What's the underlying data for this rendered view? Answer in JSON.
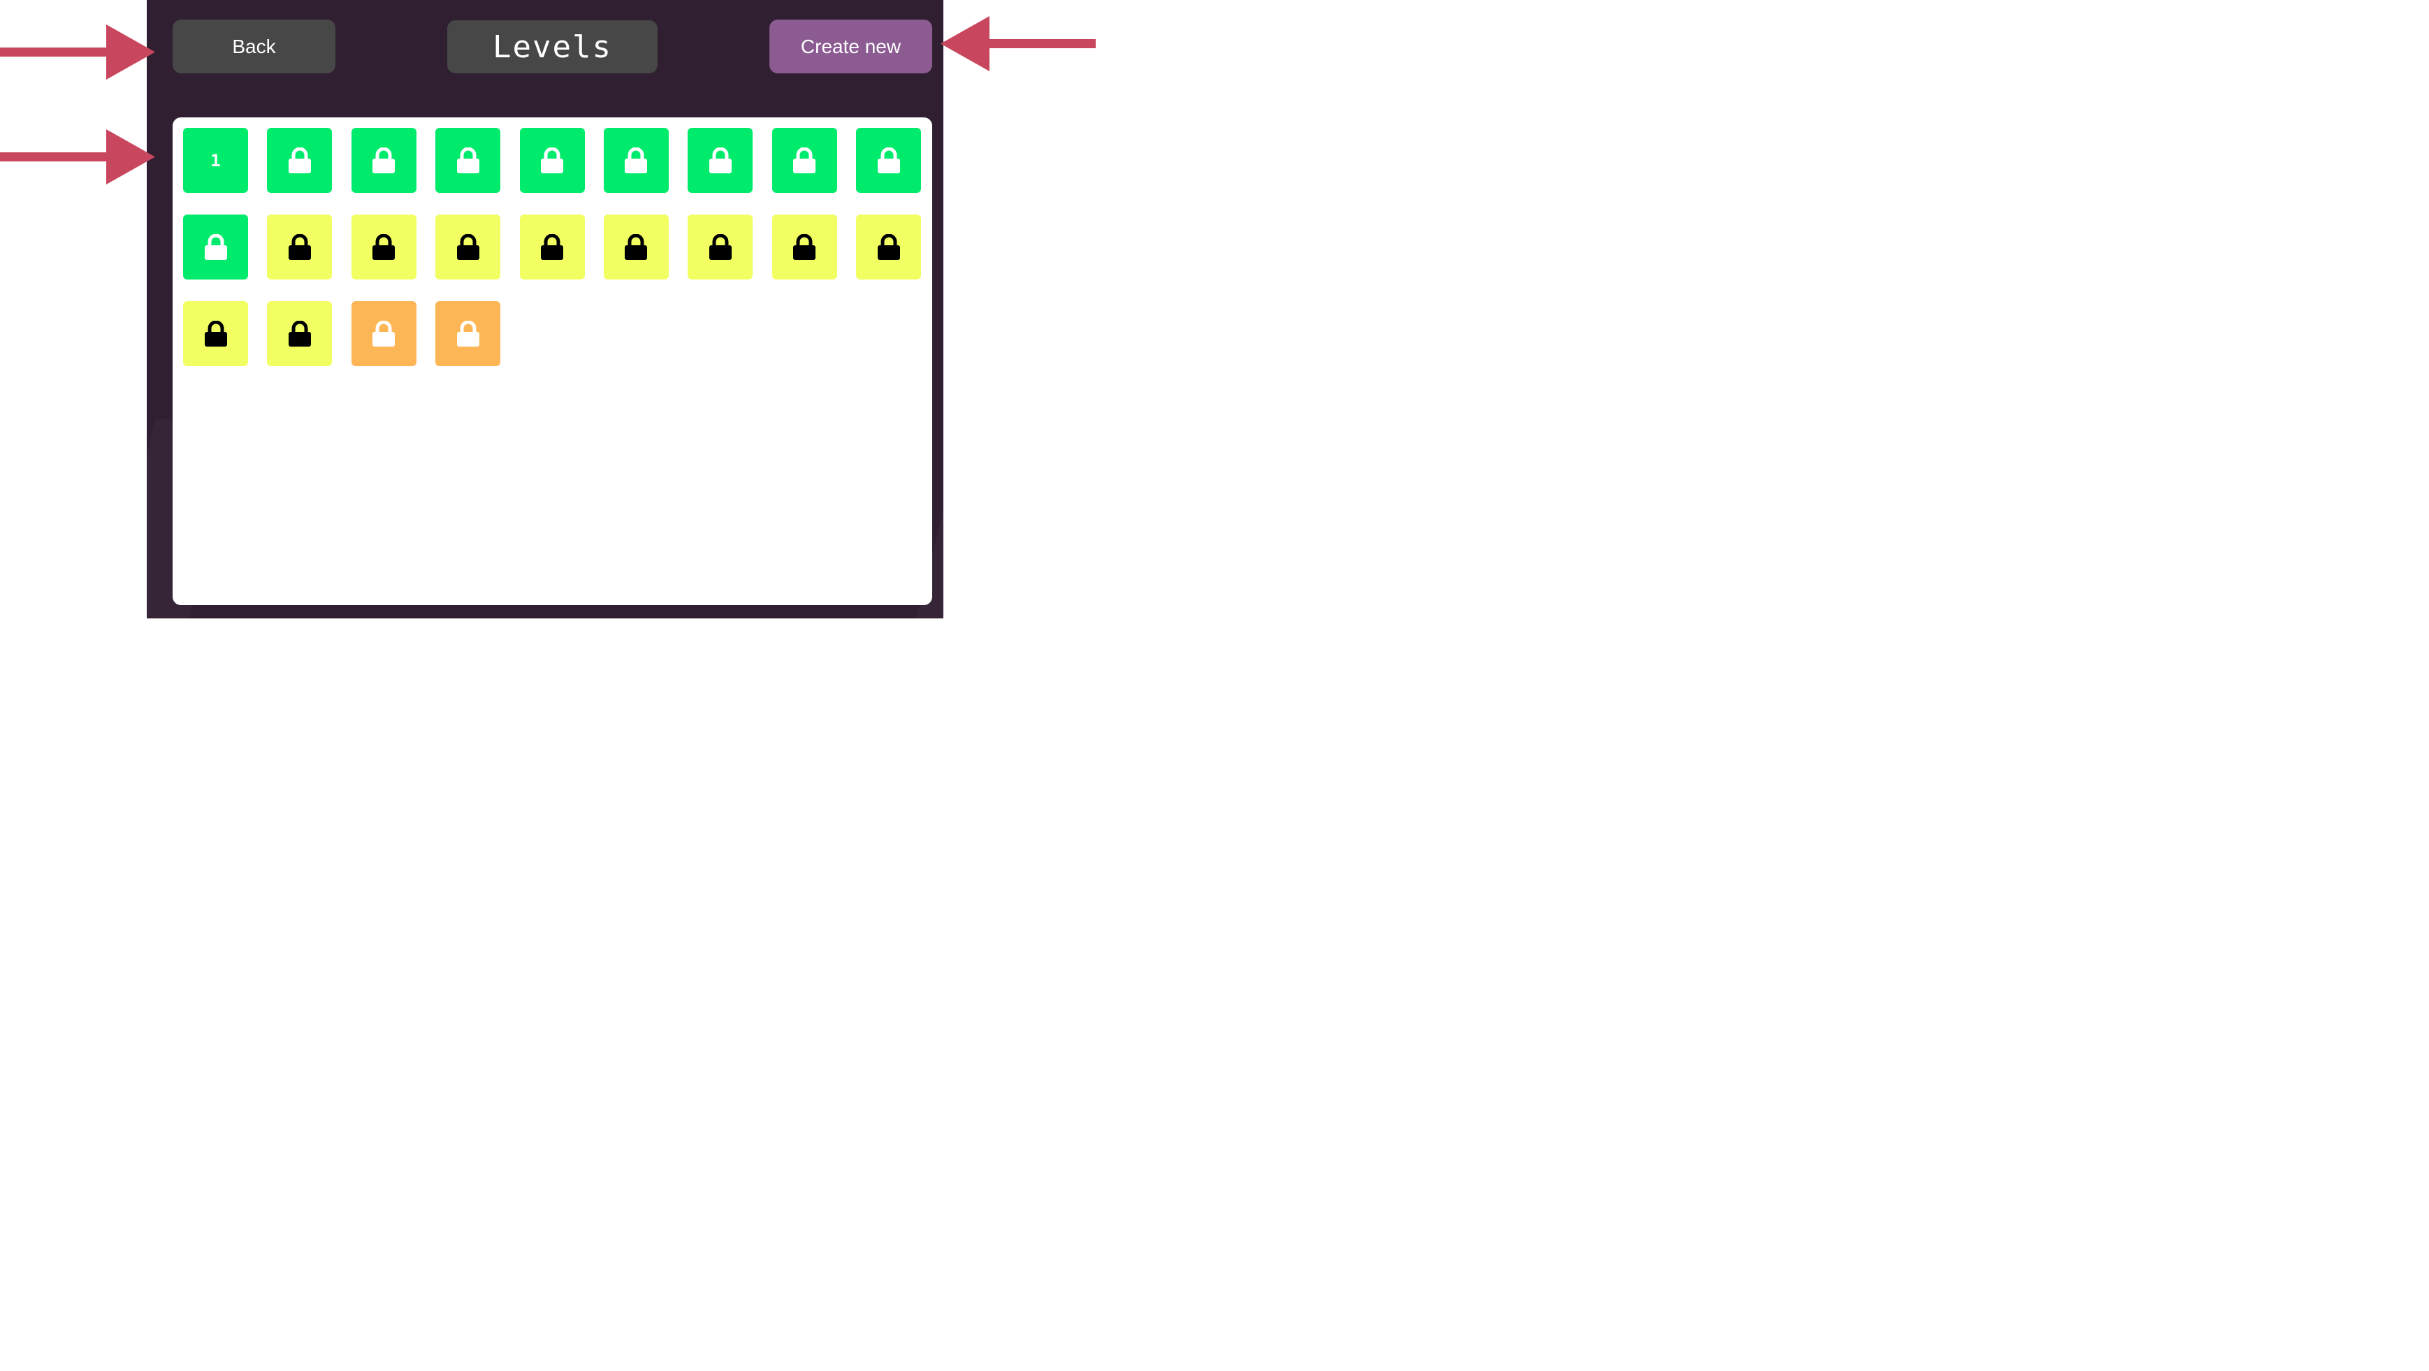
{
  "header": {
    "back_label": "Back",
    "title": "Levels",
    "create_label": "Create new"
  },
  "colors": {
    "panel_bg": "#2f1f30",
    "button_gray": "#474747",
    "create_purple": "#8b5b91",
    "arrow_red": "#c8475e",
    "status_green": "#00eb6c",
    "status_yellow": "#f2ff63",
    "status_orange": "#fdb655"
  },
  "levels": [
    {
      "label": "1",
      "status": "green",
      "icon": "number"
    },
    {
      "label": "",
      "status": "green",
      "icon": "lock-icon"
    },
    {
      "label": "",
      "status": "green",
      "icon": "lock-icon"
    },
    {
      "label": "",
      "status": "green",
      "icon": "lock-icon"
    },
    {
      "label": "",
      "status": "green",
      "icon": "lock-icon"
    },
    {
      "label": "",
      "status": "green",
      "icon": "lock-icon"
    },
    {
      "label": "",
      "status": "green",
      "icon": "lock-icon"
    },
    {
      "label": "",
      "status": "green",
      "icon": "lock-icon"
    },
    {
      "label": "",
      "status": "green",
      "icon": "lock-icon"
    },
    {
      "label": "",
      "status": "green",
      "icon": "lock-icon"
    },
    {
      "label": "",
      "status": "yellow",
      "icon": "lock-icon"
    },
    {
      "label": "",
      "status": "yellow",
      "icon": "lock-icon"
    },
    {
      "label": "",
      "status": "yellow",
      "icon": "lock-icon"
    },
    {
      "label": "",
      "status": "yellow",
      "icon": "lock-icon"
    },
    {
      "label": "",
      "status": "yellow",
      "icon": "lock-icon"
    },
    {
      "label": "",
      "status": "yellow",
      "icon": "lock-icon"
    },
    {
      "label": "",
      "status": "yellow",
      "icon": "lock-icon"
    },
    {
      "label": "",
      "status": "yellow",
      "icon": "lock-icon"
    },
    {
      "label": "",
      "status": "yellow",
      "icon": "lock-icon"
    },
    {
      "label": "",
      "status": "yellow",
      "icon": "lock-icon"
    },
    {
      "label": "",
      "status": "orange",
      "icon": "lock-icon"
    },
    {
      "label": "",
      "status": "orange",
      "icon": "lock-icon"
    }
  ],
  "annotations": [
    {
      "name": "arrow-to-back-button",
      "direction": "right"
    },
    {
      "name": "arrow-to-create-button",
      "direction": "left"
    },
    {
      "name": "arrow-to-level-grid",
      "direction": "right"
    }
  ]
}
